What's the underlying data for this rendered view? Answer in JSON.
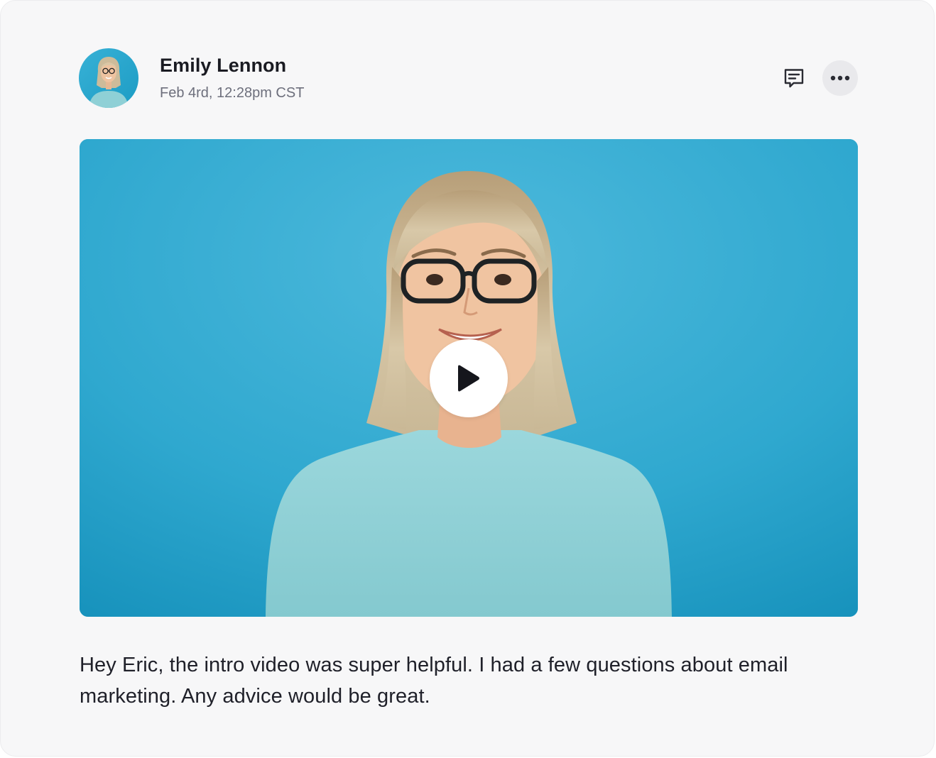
{
  "post": {
    "author_name": "Emily Lennon",
    "timestamp": "Feb 4rd, 12:28pm CST",
    "message": "Hey Eric, the intro video was super helpful. I had a few questions about email marketing. Any advice would be great."
  },
  "actions": {
    "comment_icon": "comment-icon",
    "more_icon": "more-horizontal-icon"
  },
  "video": {
    "play_icon": "play-icon",
    "background_color": "#2fa8cf"
  },
  "colors": {
    "card_background": "#f7f7f8",
    "text_primary": "#1a1b22",
    "text_secondary": "#6d6f7c"
  }
}
